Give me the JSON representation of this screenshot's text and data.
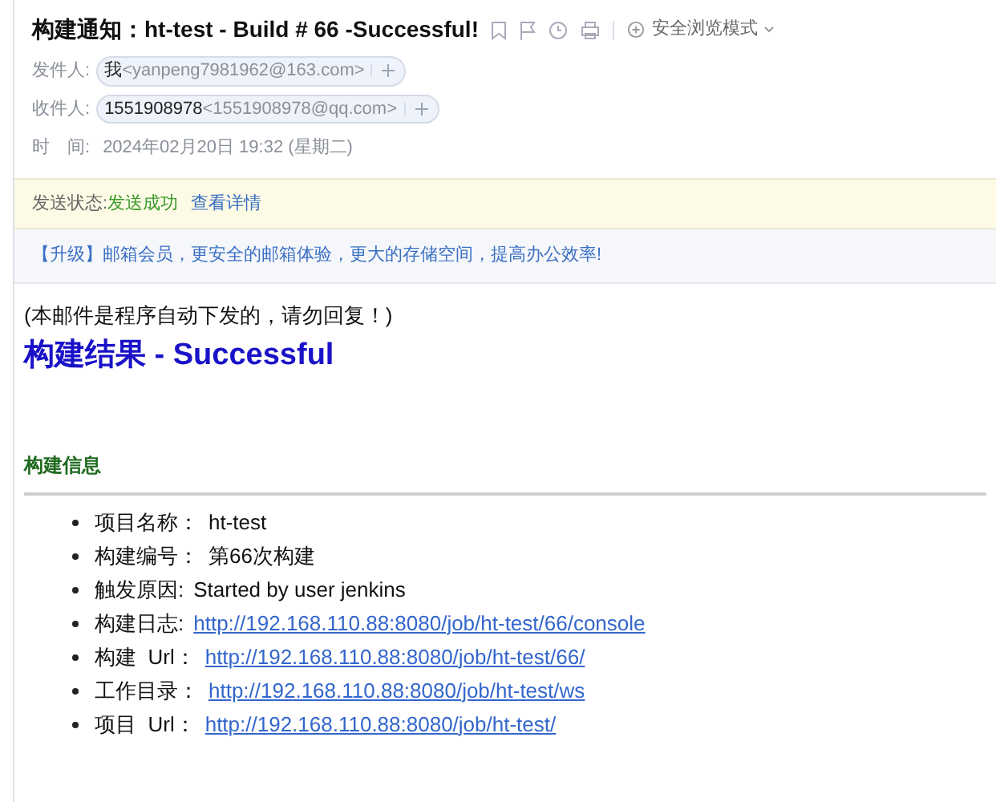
{
  "email": {
    "subject": "构建通知：ht-test - Build # 66 -Successful!",
    "safe_mode": "安全浏览模式",
    "sender": {
      "label": "发件人:",
      "name": "我",
      "address": "<yanpeng7981962@163.com>"
    },
    "recipient": {
      "label": "收件人:",
      "name": "1551908978",
      "address": "<1551908978@qq.com>"
    },
    "time": {
      "label": "时　间:",
      "value": "2024年02月20日 19:32 (星期二)"
    }
  },
  "send_status": {
    "label": "发送状态:",
    "value": "发送成功",
    "link": "查看详情"
  },
  "promo": "【升级】邮箱会员，更安全的邮箱体验，更大的存储空间，提高办公效率!",
  "body": {
    "notice": "(本邮件是程序自动下发的，请勿回复！)",
    "heading": "构建结果 - Successful",
    "section": "构建信息",
    "items": [
      {
        "kind": "text",
        "label": "项目名称：",
        "value": "ht-test"
      },
      {
        "kind": "text",
        "label": "构建编号：",
        "value": "第66次构建"
      },
      {
        "kind": "text",
        "label": "触发原因:",
        "value": "Started by user jenkins"
      },
      {
        "kind": "link",
        "label": "构建日志:",
        "value": "http://192.168.110.88:8080/job/ht-test/66/console"
      },
      {
        "kind": "link",
        "label": "构建  Url：",
        "value": "http://192.168.110.88:8080/job/ht-test/66/"
      },
      {
        "kind": "link",
        "label": "工作目录：",
        "value": "http://192.168.110.88:8080/job/ht-test/ws"
      },
      {
        "kind": "link",
        "label": "项目  Url：",
        "value": "http://192.168.110.88:8080/job/ht-test/"
      }
    ]
  }
}
